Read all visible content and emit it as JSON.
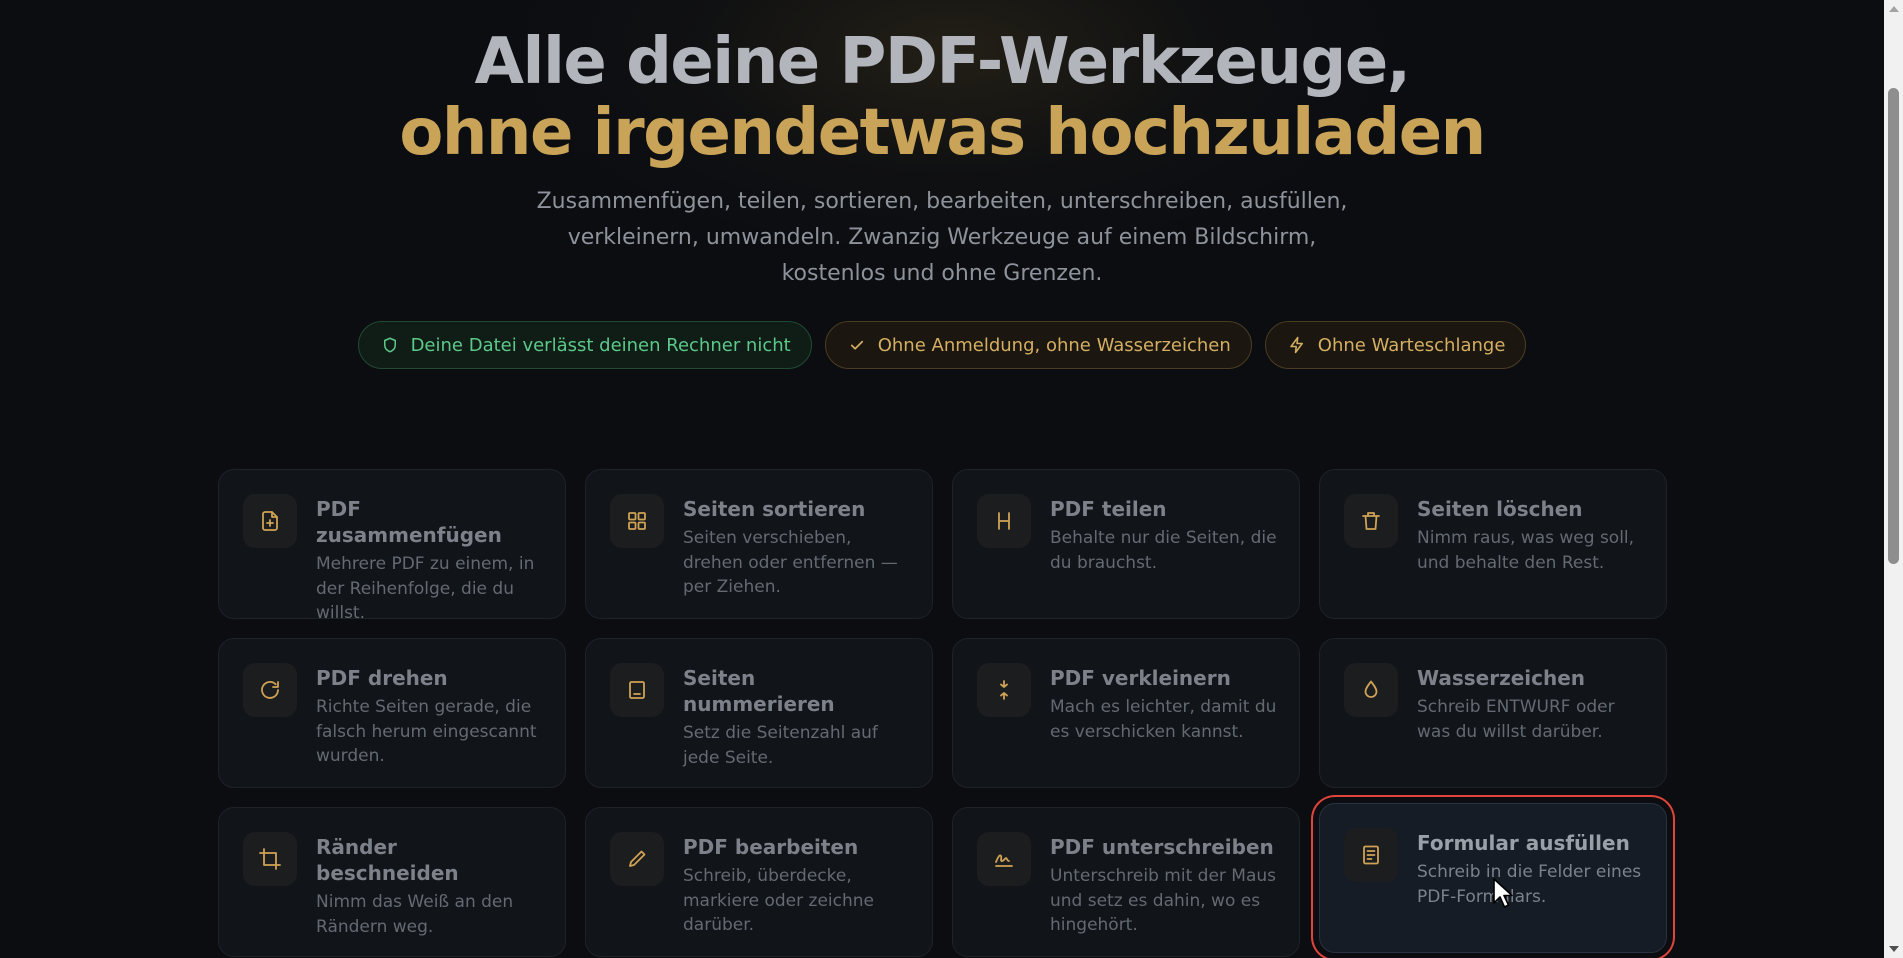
{
  "hero": {
    "title_line1": "Alle deine PDF-Werkzeuge,",
    "title_line2": "ohne irgendetwas hochzuladen",
    "subtitle": "Zusammenfügen, teilen, sortieren, bearbeiten, unterschreiben, ausfüllen, verkleinern, umwandeln. Zwanzig Werkzeuge auf einem Bildschirm, kostenlos und ohne Grenzen."
  },
  "badges": [
    {
      "label": "Deine Datei verlässt deinen Rechner nicht",
      "icon": "shield-icon"
    },
    {
      "label": "Ohne Anmeldung, ohne Wasserzeichen",
      "icon": "check-icon"
    },
    {
      "label": "Ohne Warteschlange",
      "icon": "lightning-icon"
    }
  ],
  "tools": [
    {
      "title": "PDF zusammenfügen",
      "desc": "Mehrere PDF zu einem, in der Reihenfolge, die du willst.",
      "icon": "file-plus-icon"
    },
    {
      "title": "Seiten sortieren",
      "desc": "Seiten verschieben, drehen oder entfernen — per Ziehen.",
      "icon": "grid-icon"
    },
    {
      "title": "PDF teilen",
      "desc": "Behalte nur die Seiten, die du brauchst.",
      "icon": "split-icon"
    },
    {
      "title": "Seiten löschen",
      "desc": "Nimm raus, was weg soll, und behalte den Rest.",
      "icon": "trash-icon"
    },
    {
      "title": "PDF drehen",
      "desc": "Richte Seiten gerade, die falsch herum eingescannt wurden.",
      "icon": "rotate-icon"
    },
    {
      "title": "Seiten nummerieren",
      "desc": "Setz die Seitenzahl auf jede Seite.",
      "icon": "page-number-icon"
    },
    {
      "title": "PDF verkleinern",
      "desc": "Mach es leichter, damit du es verschicken kannst.",
      "icon": "compress-icon"
    },
    {
      "title": "Wasserzeichen",
      "desc": "Schreib ENTWURF oder was du willst darüber.",
      "icon": "droplet-icon"
    },
    {
      "title": "Ränder beschneiden",
      "desc": "Nimm das Weiß an den Rändern weg.",
      "icon": "crop-icon"
    },
    {
      "title": "PDF bearbeiten",
      "desc": "Schreib, überdecke, markiere oder zeichne darüber.",
      "icon": "pencil-icon"
    },
    {
      "title": "PDF unterschreiben",
      "desc": "Unterschreib mit der Maus und setz es dahin, wo es hingehört.",
      "icon": "signature-icon"
    },
    {
      "title": "Formular ausfüllen",
      "desc": "Schreib in die Felder eines PDF-Formulars.",
      "icon": "form-icon"
    }
  ],
  "colors": {
    "accent_gold": "#c9a458",
    "badge_green": "#5cc98a",
    "highlight_border": "#e0443a",
    "background": "#0b0d11"
  }
}
